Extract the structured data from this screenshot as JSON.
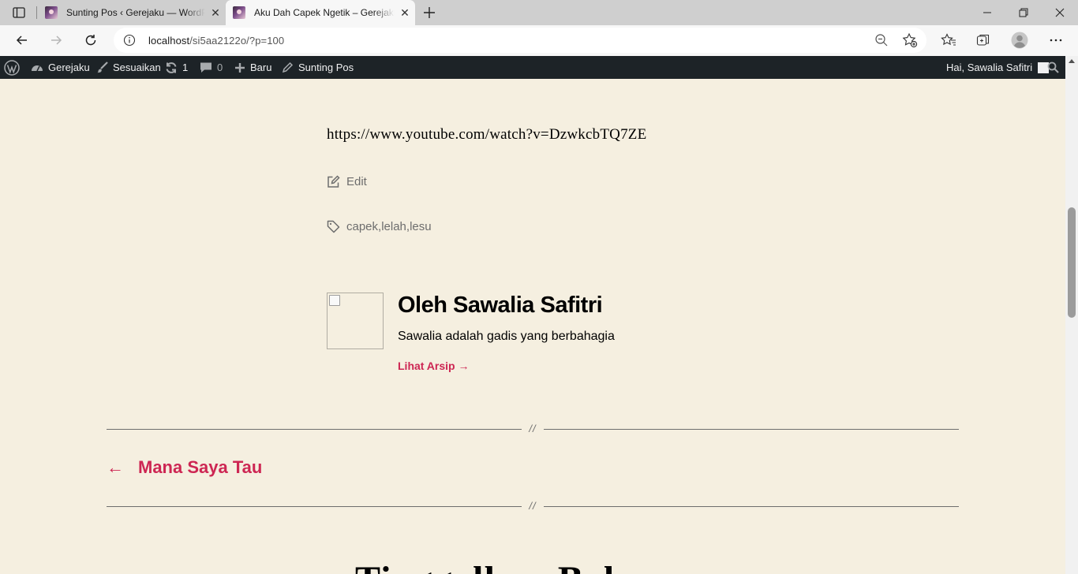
{
  "browser": {
    "tabs": [
      {
        "title": "Sunting Pos ‹ Gerejaku — WordPress",
        "active": false
      },
      {
        "title": "Aku Dah Capek Ngetik – Gerejaku",
        "active": true
      }
    ],
    "url_host": "localhost",
    "url_path": "/si5aa2122o/?p=100"
  },
  "adminbar": {
    "site_name": "Gerejaku",
    "customize": "Sesuaikan",
    "updates_count": "1",
    "comments_count": "0",
    "new_label": "Baru",
    "edit_post": "Sunting Pos",
    "greeting": "Hai, Sawalia Safitri"
  },
  "post": {
    "embed_url": "https://www.youtube.com/watch?v=DzwkcbTQ7ZE",
    "edit_label": "Edit",
    "tags": [
      "capek",
      "lelah",
      "lesu"
    ],
    "tag_separator": ", "
  },
  "author": {
    "name": "Oleh Sawalia Safitri",
    "bio": "Sawalia adalah gadis yang berbahagia",
    "archive_link": "Lihat Arsip →"
  },
  "navigation": {
    "divider_mark": "//",
    "previous_title": "Mana Saya Tau",
    "arrow": "←"
  },
  "next_section": {
    "heading_partial": "Tinggalkan Bal"
  },
  "colors": {
    "accent": "#cd2653",
    "background": "#f5efe0",
    "adminbar": "#1d2327",
    "muted_text": "#6d6d6d"
  },
  "icons": [
    "sidebar-icon",
    "close-icon",
    "plus-icon",
    "minimize-icon",
    "restore-icon",
    "back-icon",
    "forward-icon",
    "refresh-icon",
    "info-icon",
    "zoom-out-icon",
    "add-favorite-icon",
    "favorites-icon",
    "collections-icon",
    "profile-icon",
    "more-icon",
    "wordpress-icon",
    "dashboard-icon",
    "brush-icon",
    "updates-icon",
    "comment-icon",
    "pencil-icon",
    "search-icon",
    "edit-icon",
    "tag-icon"
  ]
}
